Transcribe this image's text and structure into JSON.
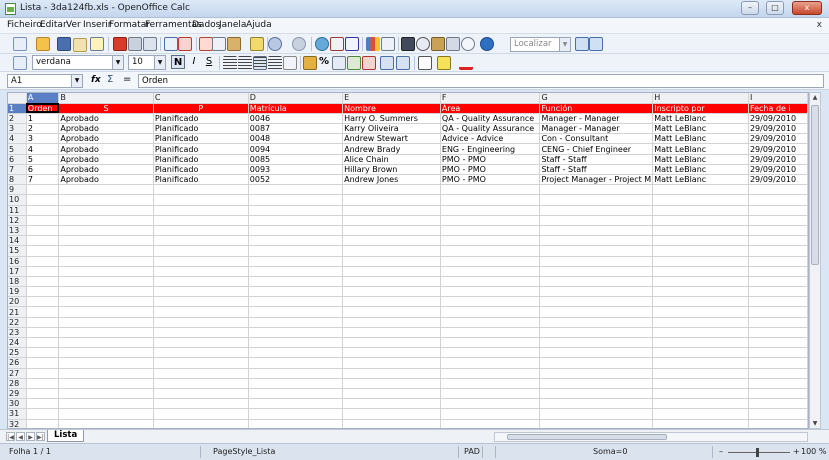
{
  "window": {
    "title": "Lista - 3da124fb.xls - OpenOffice Calc",
    "minimize": "–",
    "maximize": "□",
    "close": "x"
  },
  "menu": [
    "Ficheiro",
    "Editar",
    "Ver",
    "Inserir",
    "Formatar",
    "Ferramentas",
    "Dados",
    "Janela",
    "Ajuda"
  ],
  "menu_close": "x",
  "toolbar": {
    "find_placeholder": "Localizar",
    "font_name": "verdana",
    "font_size": "10",
    "bold": "N",
    "italic": "I",
    "underline": "S",
    "percent": "%",
    "icon_names": [
      "new-icon",
      "open-icon",
      "save-icon",
      "email-icon",
      "edit-icon",
      "pdf-icon",
      "print-icon",
      "preview-icon",
      "spellcheck-icon",
      "autospell-icon",
      "cut-icon",
      "copy-icon",
      "paste-icon",
      "clone-icon",
      "undo-icon",
      "redo-icon",
      "hyperlink-icon",
      "sort-asc-icon",
      "sort-desc-icon",
      "chart-icon",
      "draw-icon",
      "binoculars-icon",
      "navigator-icon",
      "gallery-icon",
      "datasource-icon",
      "zoom-icon",
      "help-icon"
    ]
  },
  "formula": {
    "cell_ref": "A1",
    "fx": "fx",
    "sum": "Σ",
    "equals": "=",
    "content": "Orden"
  },
  "grid": {
    "columns": [
      "A",
      "B",
      "C",
      "D",
      "E",
      "F",
      "G",
      "H",
      "I"
    ],
    "header_row": [
      "Orden",
      "S",
      "P",
      "Matrícula",
      "Nombre",
      "Área",
      "Función",
      "Inscripto por",
      "Fecha de i"
    ],
    "rows": [
      [
        "1",
        "Aprobado",
        "Planificado",
        "0046",
        "Harry O. Summers",
        "QA - Quality Assurance",
        "Manager - Manager",
        "Matt LeBlanc",
        "29/09/2010"
      ],
      [
        "2",
        "Aprobado",
        "Planificado",
        "0087",
        "Karry Oliveira",
        "QA - Quality Assurance",
        "Manager - Manager",
        "Matt LeBlanc",
        "29/09/2010"
      ],
      [
        "3",
        "Aprobado",
        "Planificado",
        "0048",
        "Andrew Stewart",
        "Advice - Advice",
        "Con - Consultant",
        "Matt LeBlanc",
        "29/09/2010"
      ],
      [
        "4",
        "Aprobado",
        "Planificado",
        "0094",
        "Andrew Brady",
        "ENG - Engineering",
        "CENG - Chief Engineer",
        "Matt LeBlanc",
        "29/09/2010"
      ],
      [
        "5",
        "Aprobado",
        "Planificado",
        "0085",
        "Alice Chain",
        "PMO - PMO",
        "Staff - Staff",
        "Matt LeBlanc",
        "29/09/2010"
      ],
      [
        "6",
        "Aprobado",
        "Planificado",
        "0093",
        "Hillary Brown",
        "PMO - PMO",
        "Staff - Staff",
        "Matt LeBlanc",
        "29/09/2010"
      ],
      [
        "7",
        "Aprobado",
        "Planificado",
        "0052",
        "Andrew Jones",
        "PMO - PMO",
        "Project Manager - Project M",
        "Matt LeBlanc",
        "29/09/2010"
      ]
    ],
    "visible_rows": 32
  },
  "tabs": {
    "sheet_name": "Lista"
  },
  "status": {
    "sheet": "Folha 1 / 1",
    "page_style": "PageStyle_Lista",
    "mode": "PAD",
    "sum": "Soma=0",
    "zoom_minus": "–",
    "zoom_plus": "+",
    "zoom": "100 %"
  },
  "colors": {
    "header_fill": "#ff0000",
    "header_text": "#ffffff",
    "active_header": "#5b7fc4"
  }
}
